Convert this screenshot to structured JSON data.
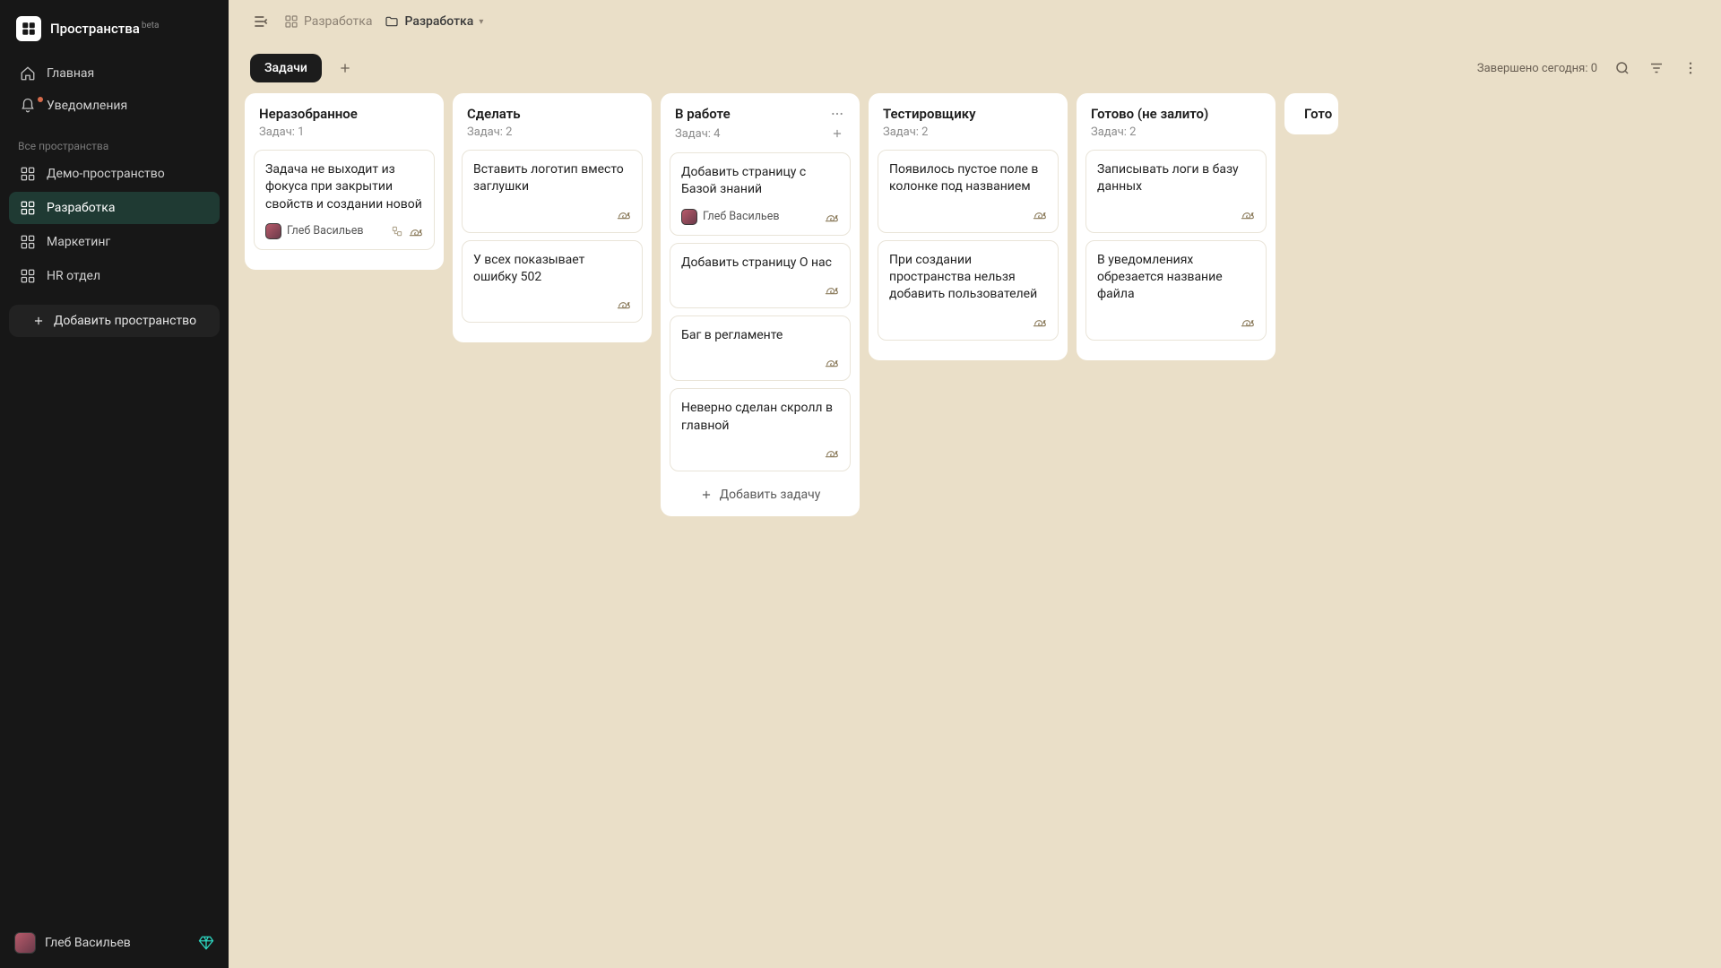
{
  "brand": {
    "title": "Пространства",
    "beta": "beta"
  },
  "sidebar": {
    "nav": [
      {
        "label": "Главная"
      },
      {
        "label": "Уведомления"
      }
    ],
    "section_label": "Все пространства",
    "spaces": [
      {
        "label": "Демо-пространство"
      },
      {
        "label": "Разработка"
      },
      {
        "label": "Маркетинг"
      },
      {
        "label": "HR отдел"
      }
    ],
    "add_space": "Добавить пространство",
    "user": "Глеб Васильев"
  },
  "breadcrumb": {
    "parent": "Разработка",
    "current": "Разработка"
  },
  "tabs": {
    "tasks": "Задачи"
  },
  "status": "Завершено сегодня: 0",
  "task_count_prefix": "Задач: ",
  "add_task_label": "Добавить задачу",
  "columns": [
    {
      "title": "Неразобранное",
      "count": "1",
      "cards": [
        {
          "title": "Задача не выходит из фокуса при закрытии свойств и создании новой",
          "assignee": "Глеб Васильев",
          "has_avatar": true,
          "has_subtask_icon": true
        }
      ]
    },
    {
      "title": "Сделать",
      "count": "2",
      "cards": [
        {
          "title": "Вставить логотип вместо заглушки"
        },
        {
          "title": "У всех показывает ошибку 502"
        }
      ]
    },
    {
      "title": "В работе",
      "count": "4",
      "hovered": true,
      "cards": [
        {
          "title": "Добавить страницу с Базой знаний",
          "assignee": "Глеб Васильев",
          "has_avatar": true
        },
        {
          "title": "Добавить страницу О нас"
        },
        {
          "title": "Баг в регламенте"
        },
        {
          "title": "Неверно сделан скролл в главной"
        }
      ]
    },
    {
      "title": "Тестировщику",
      "count": "2",
      "cards": [
        {
          "title": "Появилось пустое поле в колонке под названием"
        },
        {
          "title": "При создании пространства нельзя добавить пользователей"
        }
      ]
    },
    {
      "title": "Готово (не залито)",
      "count": "2",
      "cards": [
        {
          "title": "Записывать логи в базу данных"
        },
        {
          "title": "В уведомлениях обрезается название файла"
        }
      ]
    },
    {
      "title": "Готово",
      "ghost": true
    }
  ]
}
